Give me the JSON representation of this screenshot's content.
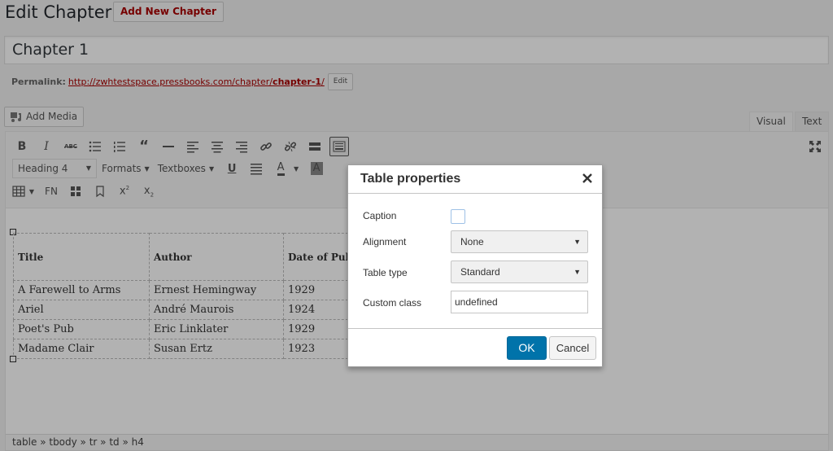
{
  "page": {
    "heading": "Edit Chapter",
    "add_new_label": "Add New Chapter",
    "title_value": "Chapter 1",
    "permalink": {
      "label": "Permalink:",
      "url_base": "http://zwhtestspace.pressbooks.com/chapter/",
      "url_slug": "chapter-1",
      "url_tail": "/",
      "edit_label": "Edit"
    },
    "add_media_label": "Add Media",
    "tabs": [
      {
        "label": "Visual",
        "active": true
      },
      {
        "label": "Text",
        "active": false
      }
    ]
  },
  "toolbar": {
    "row1": [
      "bold-icon",
      "italic-icon",
      "strikethrough-icon",
      "bullet-list-icon",
      "numbered-list-icon",
      "blockquote-icon",
      "horizontal-rule-icon",
      "align-left-icon",
      "align-center-icon",
      "align-right-icon",
      "link-icon",
      "unlink-icon",
      "read-more-icon",
      "toolbar-toggle-icon"
    ],
    "format_select": "Heading 4",
    "formats_label": "Formats",
    "textboxes_label": "Textboxes",
    "fn_label": "FN"
  },
  "table": {
    "headers": [
      "Title",
      "Author",
      "Date of Pub"
    ],
    "rows": [
      [
        "A Farewell to Arms",
        "Ernest Hemingway",
        "1929"
      ],
      [
        "Ariel",
        "André Maurois",
        "1924"
      ],
      [
        "Poet's Pub",
        "Eric Linklater",
        "1929"
      ],
      [
        "Madame Clair",
        "Susan Ertz",
        "1923"
      ]
    ]
  },
  "statusbar": {
    "path": "table » tbody » tr » td » h4"
  },
  "dialog": {
    "title": "Table properties",
    "fields": {
      "caption_label": "Caption",
      "caption_checked": false,
      "alignment_label": "Alignment",
      "alignment_value": "None",
      "table_type_label": "Table type",
      "table_type_value": "Standard",
      "custom_class_label": "Custom class",
      "custom_class_value": "undefined"
    },
    "ok_label": "OK",
    "cancel_label": "Cancel"
  },
  "colors": {
    "accent": "#0073aa",
    "link": "#aa0000",
    "overlay": "rgba(0,0,0,0.3)"
  }
}
